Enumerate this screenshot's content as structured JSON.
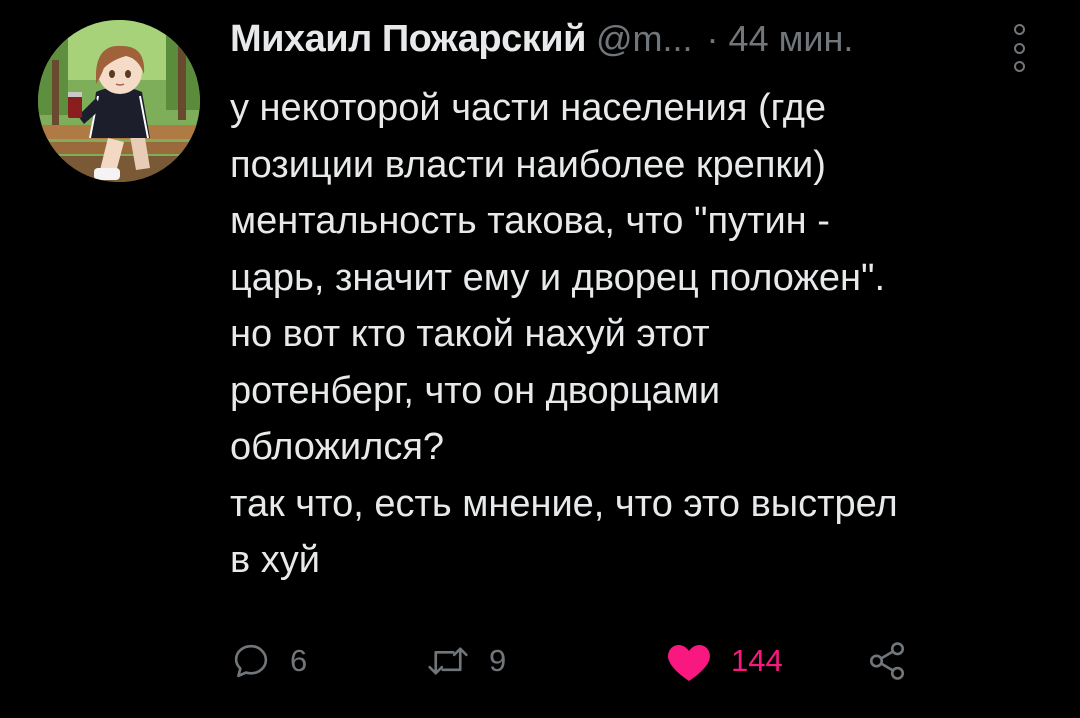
{
  "tweet": {
    "display_name": "Михаил Пожарский",
    "handle": "@m...",
    "separator": "·",
    "time": "44 мин.",
    "text": "у некоторой части населения (где\nпозиции власти наиболее крепки)\nментальность такова, что \"путин -\nцарь, значит ему и дворец положен\".\nно вот кто такой нахуй этот\nротенберг, что он дворцами\nобложился?\nтак что, есть мнение, что это выстрел\nв хуй",
    "actions": {
      "reply_count": "6",
      "retweet_count": "9",
      "like_count": "144"
    }
  },
  "icons": {
    "reply": "reply-icon",
    "retweet": "retweet-icon",
    "like": "heart-icon",
    "share": "share-icon",
    "more": "more-options-icon"
  },
  "colors": {
    "background": "#000000",
    "text_primary": "#e7e9ea",
    "text_secondary": "#71767b",
    "like_active": "#f91880"
  }
}
